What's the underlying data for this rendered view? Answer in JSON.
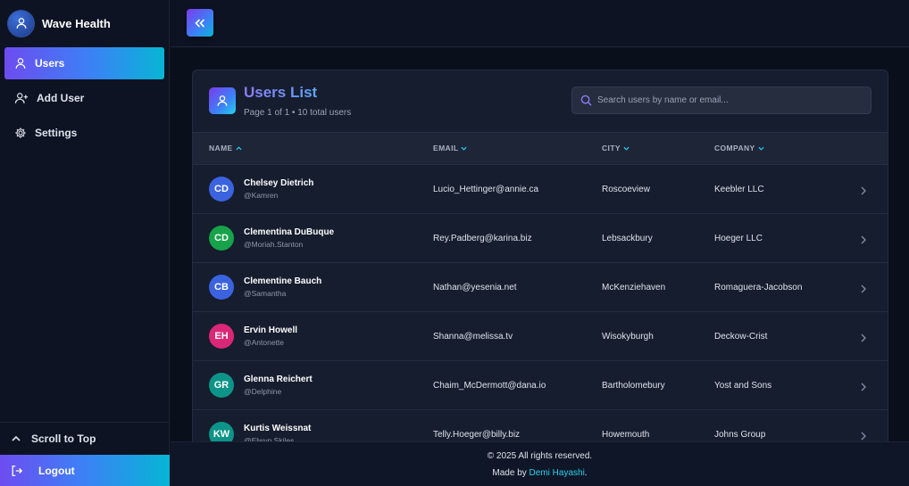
{
  "app": {
    "name": "Wave Health"
  },
  "sidebar": {
    "items": [
      {
        "label": "Users",
        "icon": "user-icon",
        "active": true
      },
      {
        "label": "Add User",
        "icon": "user-plus-icon",
        "active": false
      },
      {
        "label": "Settings",
        "icon": "gear-icon",
        "active": false
      }
    ],
    "scroll_top_label": "Scroll to Top",
    "logout_label": "Logout"
  },
  "card": {
    "title": "Users List",
    "subtitle": "Page 1 of 1 • 10 total users",
    "search_placeholder": "Search users by name or email..."
  },
  "table": {
    "columns": [
      "NAME",
      "EMAIL",
      "CITY",
      "COMPANY"
    ],
    "rows": [
      {
        "initials": "CD",
        "name": "Chelsey Dietrich",
        "username": "@Kamren",
        "email": "Lucio_Hettinger@annie.ca",
        "city": "Roscoeview",
        "company": "Keebler LLC",
        "color": "#3b63e0"
      },
      {
        "initials": "CD",
        "name": "Clementina DuBuque",
        "username": "@Moriah.Stanton",
        "email": "Rey.Padberg@karina.biz",
        "city": "Lebsackbury",
        "company": "Hoeger LLC",
        "color": "#16a34a"
      },
      {
        "initials": "CB",
        "name": "Clementine Bauch",
        "username": "@Samantha",
        "email": "Nathan@yesenia.net",
        "city": "McKenziehaven",
        "company": "Romaguera-Jacobson",
        "color": "#3b63e0"
      },
      {
        "initials": "EH",
        "name": "Ervin Howell",
        "username": "@Antonette",
        "email": "Shanna@melissa.tv",
        "city": "Wisokyburgh",
        "company": "Deckow-Crist",
        "color": "#db2777"
      },
      {
        "initials": "GR",
        "name": "Glenna Reichert",
        "username": "@Delphine",
        "email": "Chaim_McDermott@dana.io",
        "city": "Bartholomebury",
        "company": "Yost and Sons",
        "color": "#0d9488"
      },
      {
        "initials": "KW",
        "name": "Kurtis Weissnat",
        "username": "@Elwyn.Skiles",
        "email": "Telly.Hoeger@billy.biz",
        "city": "Howemouth",
        "company": "Johns Group",
        "color": "#0d9488"
      }
    ]
  },
  "footer": {
    "copyright": "© 2025 All rights reserved.",
    "made_by_prefix": "Made by ",
    "author": "Demi Hayashi",
    "suffix": "."
  }
}
